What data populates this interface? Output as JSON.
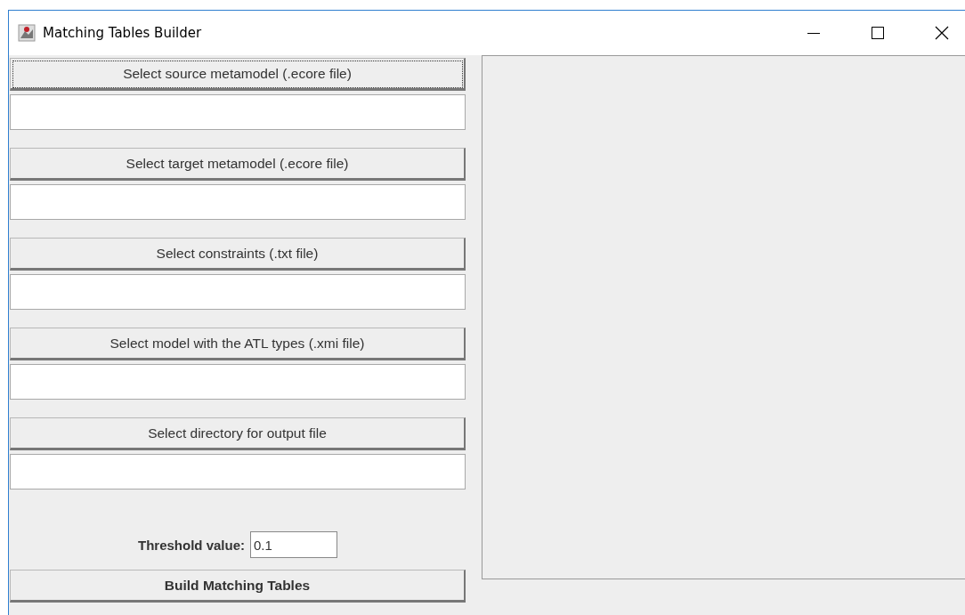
{
  "window": {
    "title": "Matching Tables Builder"
  },
  "file_selectors": [
    {
      "button": "Select source metamodel (.ecore file)",
      "focused": true
    },
    {
      "button": "Select target metamodel (.ecore file)",
      "focused": false
    },
    {
      "button": "Select constraints (.txt file)",
      "focused": false
    },
    {
      "button": "Select model with the ATL types (.xmi file)",
      "focused": false
    },
    {
      "button": "Select directory for output file",
      "focused": false
    }
  ],
  "threshold": {
    "label": "Threshold value:",
    "value": "0.1"
  },
  "build_button": "Build Matching Tables"
}
